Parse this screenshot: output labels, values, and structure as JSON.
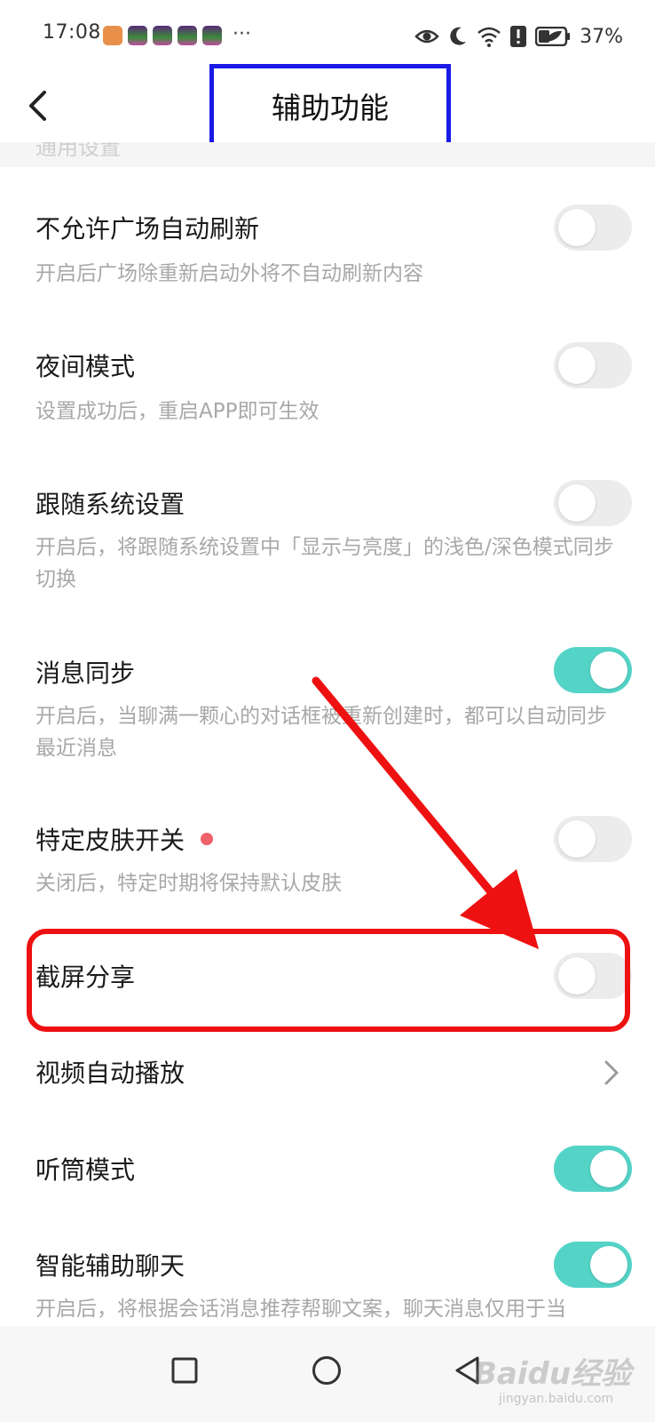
{
  "status_bar": {
    "time": "17:08",
    "more": "···",
    "battery": "37%",
    "icons": [
      "eye-icon",
      "moon-icon",
      "wifi-icon",
      "alert-icon",
      "battery-icon"
    ]
  },
  "header": {
    "title": "辅助功能",
    "back_icon": "chevron-left-icon"
  },
  "section_peek": "通用设置",
  "settings": [
    {
      "title": "不允许广场自动刷新",
      "desc": "开启后广场除重新启动外将不自动刷新内容",
      "control": "toggle",
      "on": false
    },
    {
      "title": "夜间模式",
      "desc": "设置成功后，重启APP即可生效",
      "control": "toggle",
      "on": false
    },
    {
      "title": "跟随系统设置",
      "desc": "开启后，将跟随系统设置中「显示与亮度」的浅色/深色模式同步切换",
      "control": "toggle",
      "on": false
    },
    {
      "title": "消息同步",
      "desc": "开启后，当聊满一颗心的对话框被重新创建时，都可以自动同步最近消息",
      "control": "toggle",
      "on": true
    },
    {
      "title": "特定皮肤开关",
      "desc": "关闭后，特定时期将保持默认皮肤",
      "control": "toggle",
      "on": false,
      "badge": "red-dot"
    },
    {
      "title": "截屏分享",
      "desc": "",
      "control": "toggle",
      "on": false
    },
    {
      "title": "视频自动播放",
      "desc": "",
      "control": "chevron"
    },
    {
      "title": "听筒模式",
      "desc": "",
      "control": "toggle",
      "on": true
    },
    {
      "title": "智能辅助聊天",
      "desc": "开启后，将根据会话消息推荐帮聊文案，聊天消息仅用于当",
      "control": "toggle",
      "on": true
    }
  ],
  "colors": {
    "toggle_on": "#54d3c7",
    "toggle_off": "#ececec",
    "annotation_red": "#ee1111",
    "annotation_blue": "#1a1ae6"
  },
  "watermark": {
    "brand": "Baidu经验",
    "url": "jingyan.baidu.com"
  }
}
